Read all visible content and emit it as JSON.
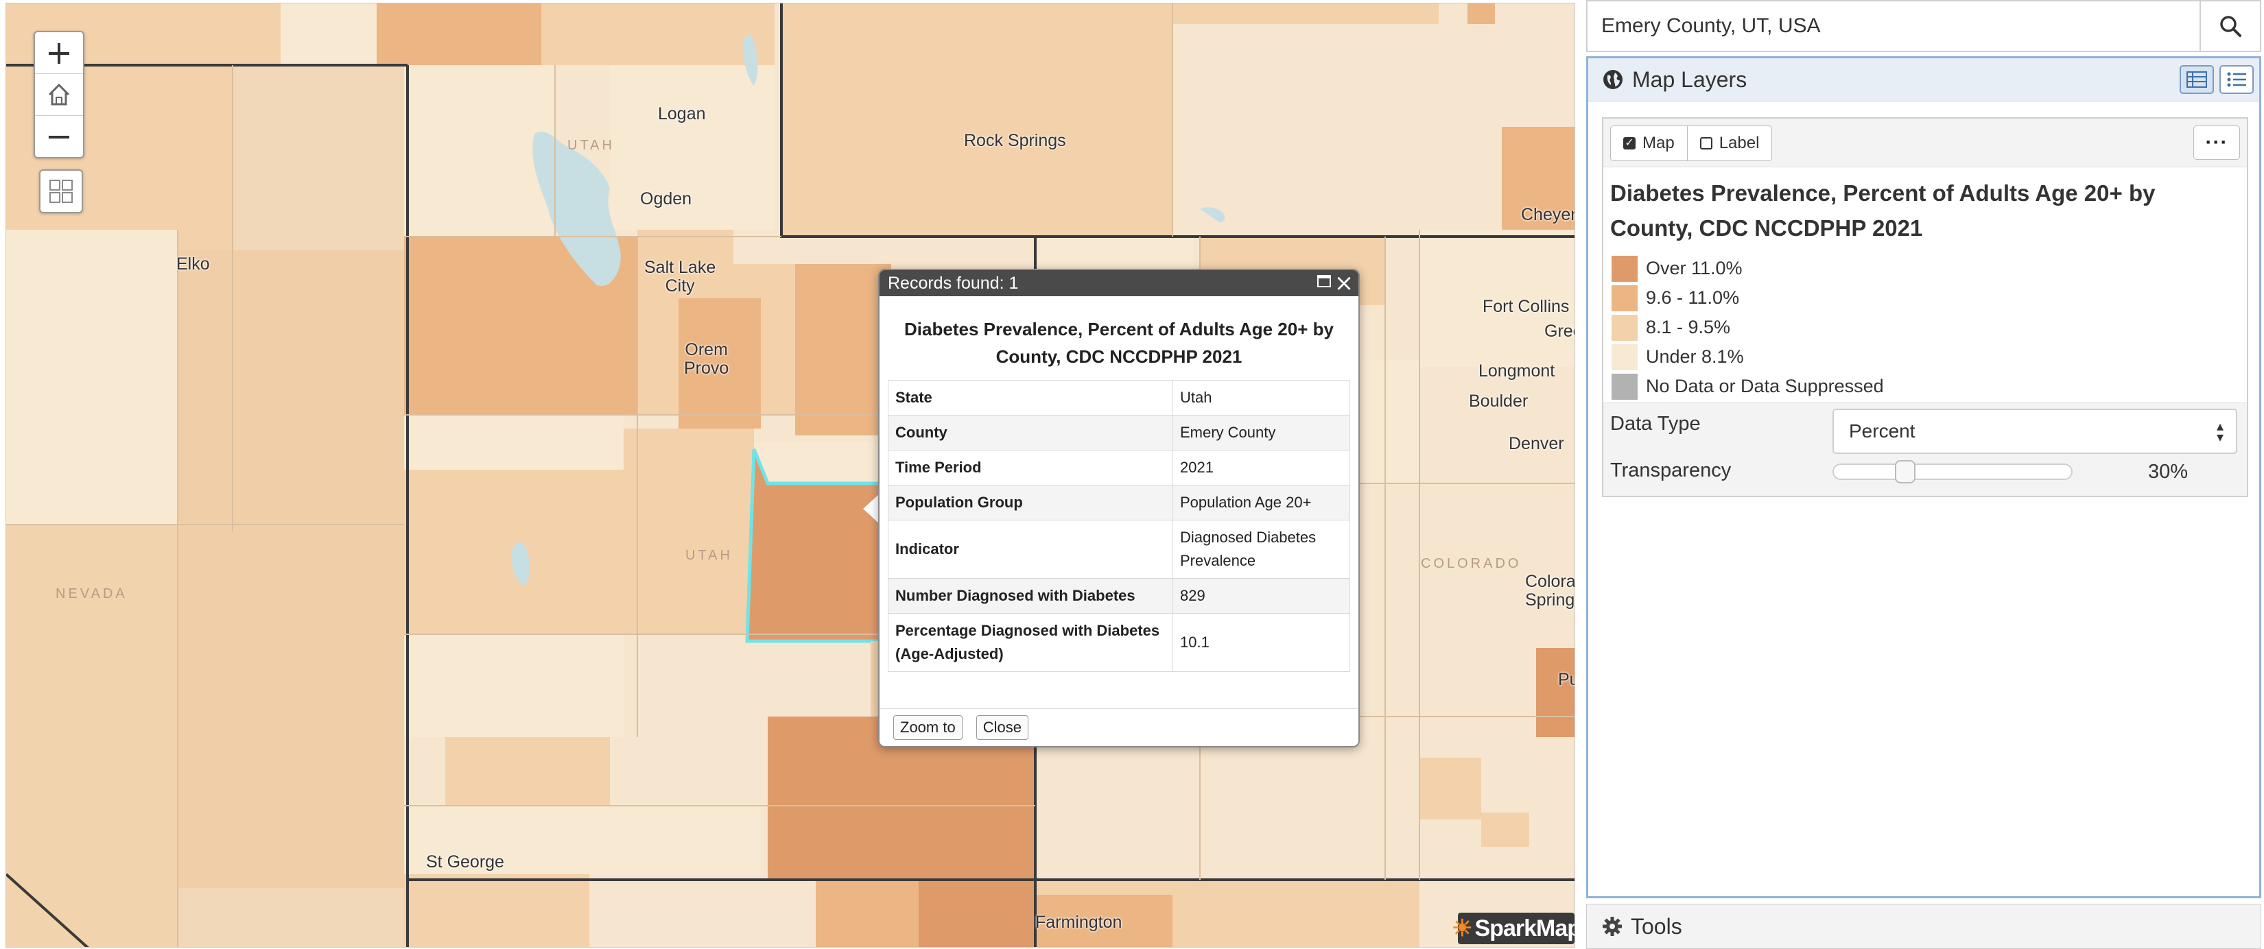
{
  "map": {
    "places": [
      {
        "name": "Logan",
        "id": "logan"
      },
      {
        "name": "Ogden",
        "id": "ogden"
      },
      {
        "name": "Salt Lake\nCity",
        "id": "salt-lake-city"
      },
      {
        "name": "Orem\nProvo",
        "id": "orem-provo"
      },
      {
        "name": "Rock Springs",
        "id": "rock-springs"
      },
      {
        "name": "Elko",
        "id": "elko"
      },
      {
        "name": "Cheyen",
        "id": "cheyenne"
      },
      {
        "name": "Fort Collins",
        "id": "fort-collins"
      },
      {
        "name": "Gree",
        "id": "greeley"
      },
      {
        "name": "Longmont",
        "id": "longmont"
      },
      {
        "name": "Boulder",
        "id": "boulder"
      },
      {
        "name": "Denver",
        "id": "denver"
      },
      {
        "name": "Colora\nSpring",
        "id": "colorado-springs"
      },
      {
        "name": "Pu",
        "id": "pueblo"
      },
      {
        "name": "St George",
        "id": "st-george"
      },
      {
        "name": "Farmington",
        "id": "farmington"
      }
    ],
    "state_labels": [
      {
        "name": "UTAH",
        "id": "utah-north"
      },
      {
        "name": "UTAH",
        "id": "utah-central"
      },
      {
        "name": "NEVADA",
        "id": "nevada"
      },
      {
        "name": "COLORADO",
        "id": "colorado"
      }
    ],
    "zoom_in_label": "+",
    "zoom_out_label": "−",
    "attribution_logo_text": "SparkMap",
    "selected_county": "Emery County",
    "colors": {
      "over_11": "#df9a6a",
      "b9_6_11": "#ebb584",
      "b8_1_9_5": "#f3d1ab",
      "under_8_1": "#f8e9d2",
      "no_data": "#b2b2b2",
      "selection": "#6fe3e8"
    }
  },
  "popup": {
    "header": "Records found: 1",
    "title": "Diabetes Prevalence, Percent of Adults Age 20+ by County, CDC NCCDPHP 2021",
    "rows": [
      {
        "key": "State",
        "value": "Utah"
      },
      {
        "key": "County",
        "value": "Emery County"
      },
      {
        "key": "Time Period",
        "value": "2021"
      },
      {
        "key": "Population Group",
        "value": "Population Age 20+"
      },
      {
        "key": "Indicator",
        "value": "Diagnosed Diabetes Prevalence"
      },
      {
        "key": "Number Diagnosed with Diabetes",
        "value": "829"
      },
      {
        "key": "Percentage Diagnosed with Diabetes (Age-Adjusted)",
        "value": "10.1"
      }
    ],
    "zoom_to_label": "Zoom to",
    "close_label": "Close"
  },
  "sidebar": {
    "search": {
      "value": "Emery County, UT, USA",
      "placeholder": ""
    },
    "layers_panel": {
      "title": "Map Layers",
      "map_toggle_label": "Map",
      "label_toggle_label": "Label",
      "map_checked": true,
      "label_checked": false,
      "more_label": "···",
      "layer_title": "Diabetes Prevalence, Percent of Adults Age 20+ by County, CDC NCCDPHP 2021",
      "legend": [
        {
          "label": "Over 11.0%",
          "color": "#df9a6a"
        },
        {
          "label": "9.6 - 11.0%",
          "color": "#ebb584"
        },
        {
          "label": "8.1 - 9.5%",
          "color": "#f3d1ab"
        },
        {
          "label": "Under 8.1%",
          "color": "#f8e9d2"
        },
        {
          "label": "No Data or Data Suppressed",
          "color": "#b2b2b2"
        }
      ],
      "data_type_label": "Data Type",
      "data_type_value": "Percent",
      "transparency_label": "Transparency",
      "transparency_value": "30%",
      "transparency_fraction": 0.3
    },
    "tools_label": "Tools"
  }
}
